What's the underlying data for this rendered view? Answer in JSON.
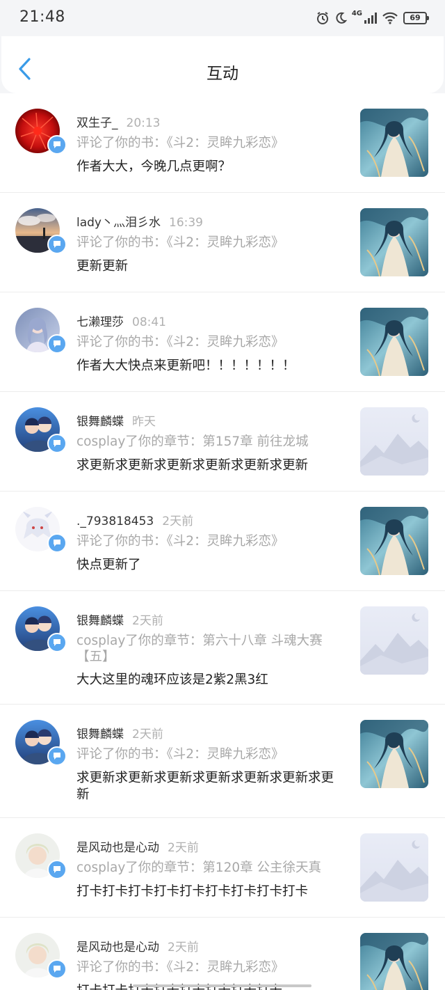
{
  "status_bar": {
    "time": "21:48",
    "network": "4G",
    "battery": "69"
  },
  "header": {
    "title": "互动"
  },
  "items": [
    {
      "user": "双生子_",
      "time": "20:13",
      "action": "评论了你的书：《斗2：灵眸九彩恋》",
      "content": "作者大大，今晚几点更啊？"
    },
    {
      "user": "lady丶灬泪彡水",
      "time": "16:39",
      "action": "评论了你的书：《斗2：灵眸九彩恋》",
      "content": "更新更新"
    },
    {
      "user": "七濑理莎",
      "time": "08:41",
      "action": "评论了你的书：《斗2：灵眸九彩恋》",
      "content": "作者大大快点来更新吧！！！！！！！"
    },
    {
      "user": "银舞麟蝶",
      "time": "昨天",
      "action": "cosplay了你的章节：第157章 前往龙城",
      "content": "求更新求更新求更新求更新求更新求更新"
    },
    {
      "user": "._793818453",
      "time": "2天前",
      "action": "评论了你的书：《斗2：灵眸九彩恋》",
      "content": "快点更新了"
    },
    {
      "user": "银舞麟蝶",
      "time": "2天前",
      "action": "cosplay了你的章节：第六十八章 斗魂大赛【五】",
      "content": "大大这里的魂环应该是2紫2黑3红"
    },
    {
      "user": "银舞麟蝶",
      "time": "2天前",
      "action": "评论了你的书：《斗2：灵眸九彩恋》",
      "content": "求更新求更新求更新求更新求更新求更新求更新"
    },
    {
      "user": "是风动也是心动",
      "time": "2天前",
      "action": "cosplay了你的章节：第120章 公主徐天真",
      "content": "打卡打卡打卡打卡打卡打卡打卡打卡打卡"
    },
    {
      "user": "是风动也是心动",
      "time": "2天前",
      "action": "评论了你的书：《斗2：灵眸九彩恋》",
      "content": "打卡打卡打卡打卡打卡打卡打卡打卡"
    }
  ]
}
